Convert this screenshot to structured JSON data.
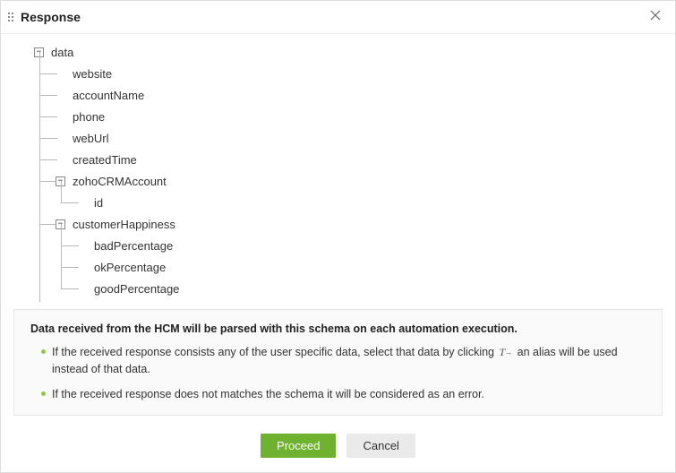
{
  "dialog": {
    "title": "Response"
  },
  "tree": {
    "root": "data",
    "items": {
      "website": "website",
      "accountName": "accountName",
      "phone": "phone",
      "webUrl": "webUrl",
      "createdTime": "createdTime",
      "zohoCRMAccount": "zohoCRMAccount",
      "zohoCRMAccount_id": "id",
      "customerHappiness": "customerHappiness",
      "badPercentage": "badPercentage",
      "okPercentage": "okPercentage",
      "goodPercentage": "goodPercentage",
      "id": "id"
    }
  },
  "info": {
    "title": "Data received from the HCM will be parsed with this schema on each automation execution.",
    "bullet1a": "If the received response consists any of the user specific data, select that data by clicking ",
    "bullet1b": " an alias will be used instead of that data.",
    "bullet2": "If the received response does not matches the schema it will be considered as an error."
  },
  "buttons": {
    "proceed": "Proceed",
    "cancel": "Cancel"
  }
}
